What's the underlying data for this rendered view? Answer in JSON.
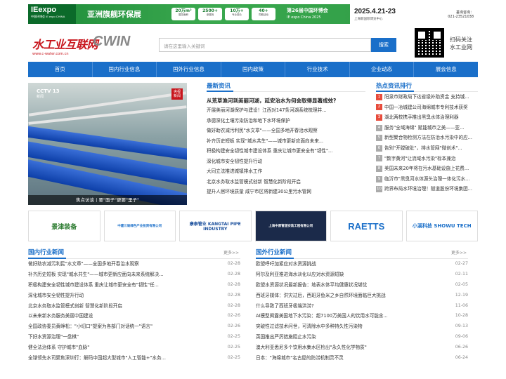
{
  "banner": {
    "logo": "IEexpo",
    "logo_sub": "中国环博会 IE expo CHINA",
    "slogan": "亚洲旗舰环保展",
    "stats": [
      {
        "value": "20万m²",
        "label": "展览面积"
      },
      {
        "value": "2500+",
        "label": "参展商"
      },
      {
        "value": "10万+",
        "label": "专业观众"
      },
      {
        "value": "40+",
        "label": "同期活动"
      }
    ],
    "show_name": "第26届中国环博会",
    "show_en": "IE expo China 2025",
    "date": "2025.4.21-23",
    "venue": "上海新国际博览中心",
    "phone_label": "垂询咨询：",
    "phone": "021-23521038"
  },
  "header": {
    "logo_cn": "水工业互联网",
    "logo_en": "CWIN",
    "logo_url": "www.c-water.com.cn",
    "search_placeholder": "请在这里输入关键词",
    "search_button": "搜索",
    "qr_text_line1": "扫码关注",
    "qr_text_line2": "水工业网"
  },
  "nav": [
    "首页",
    "国内行业信息",
    "国外行业信息",
    "国内政策",
    "行业技术",
    "企业动态",
    "展会信息"
  ],
  "hero": {
    "channel": "CCTV 13",
    "channel_sub": "新闻",
    "live": "央视 新闻",
    "caption": "焦点访谈丨要\"面子\"更要\"里子\""
  },
  "latest": {
    "title": "最新资讯",
    "headline": "从荒草渔河到美丽河湖，延安治水为何会取得显著成效?",
    "items": [
      "开展美丽河湖保护与建设！江西对147条河湖系统梳理并...",
      "承德深化土壤污染防治和地下水环境保护",
      "做好助农减污利民\"水文章\"——全国多地开春治水观察",
      "补齐历史短板 实现\"城水共生\"——城市更新应面向未来...",
      "积极构建安全韧性城市建设体系 重庆让城市更安全有\"韧性\"...",
      "深化城市安全韧性提升行动",
      "大同立法推进城镇排水工作",
      "北京水务取水监管模式创新 智慧化新阶段开启",
      "提升人居环境质量 咸宁市区将新建30公里污水管网"
    ]
  },
  "hot": {
    "title": "热点资讯排行",
    "items": [
      "阳泉市财政局下达省级补助资金 支持城...",
      "中国一冶城建公司海绵城市专利技术获奖",
      "湖北两校携手推出黑臭水体治理利器",
      "服务\"全域海绵\" 赋能城市之美——亚...",
      "新型聚合物检测方法在防治水污染中的应...",
      "告别\"开膛破肚\"，排水管网\"微创术\"...",
      "\"数字黄河\"让流域水污染\"标本兼治",
      "美国未来20年将在污水基础设施上花费...",
      "临沂市\"黑臭河水体源头治理一体化污水...",
      "跨界布局水环境治理！隧道股份环境集团..."
    ]
  },
  "partners": [
    "景津装备",
    "中建三局绿色产业投资有限公司",
    "康泰管业 KANGTAI PIPE INDUSTRY",
    "上海中原管道安装工程有限公司",
    "RAETTS",
    "小溪科技 SHOWU TECH"
  ],
  "china_news": {
    "title": "国内行业新闻",
    "more": "更多>>",
    "items": [
      {
        "title": "做好助农减污利民\"水文章\"——全国多地开春治水观察",
        "date": "02-28"
      },
      {
        "title": "补齐历史短板 实现\"城水共生\"——城市更新应面向未来系统解决...",
        "date": "02-28"
      },
      {
        "title": "积极构建安全韧性城市建设体系 重庆让城市更安全有\"韧性\"任...",
        "date": "02-28"
      },
      {
        "title": "深化城市安全韧性提升行动",
        "date": "02-28"
      },
      {
        "title": "北京水务取水监管模式创新 智慧化新阶段开启",
        "date": "02-28"
      },
      {
        "title": "以未来新水务服务美丽中国建设",
        "date": "02-26"
      },
      {
        "title": "全国政协委员黄峥松：\"小切口\"提案为各部门对话统一\"语言\"",
        "date": "02-26"
      },
      {
        "title": "下好水资源治理\"一盘棋\"",
        "date": "02-25"
      },
      {
        "title": "健全法治体系 守护城市\"血脉\"",
        "date": "02-25"
      },
      {
        "title": "全球领先水司聚焦深圳行：解码中国超大型城市\"人工智能+\"水务...",
        "date": "02-25"
      }
    ]
  },
  "world_news": {
    "title": "国外行业新闻",
    "more": "更多>>",
    "items": [
      {
        "title": "欧盟呼吁加紧应对水资源挑战",
        "date": "02-27"
      },
      {
        "title": "阿尔及利亚推进海水淡化以应对水资源短缺",
        "date": "02-11"
      },
      {
        "title": "欧盟水资源状况最新报告：地表水体平均健康状况堪忧",
        "date": "02-05"
      },
      {
        "title": "西班牙媒体：洪灾过后，西班牙鱼米之乡自然环境面临巨大挑战",
        "date": "12-19"
      },
      {
        "title": "什么导致了西班牙极端洪涝?",
        "date": "11-06"
      },
      {
        "title": "AI模型揭露美国地下水污染：超7100万美国人的饮用水可能含...",
        "date": "10-28"
      },
      {
        "title": "突破性过滤技术问世，可清除水中多种持久性污染物",
        "date": "09-13"
      },
      {
        "title": "英国推出严厉措施阻止水污染",
        "date": "09-06"
      },
      {
        "title": "澳大利亚悉尼多个饮用水集水区检出\"永久性化学物质\"",
        "date": "06-26"
      },
      {
        "title": "日本：\"海绵城市\"名古屋的防涝机制灵不灵",
        "date": "06-24"
      }
    ]
  }
}
